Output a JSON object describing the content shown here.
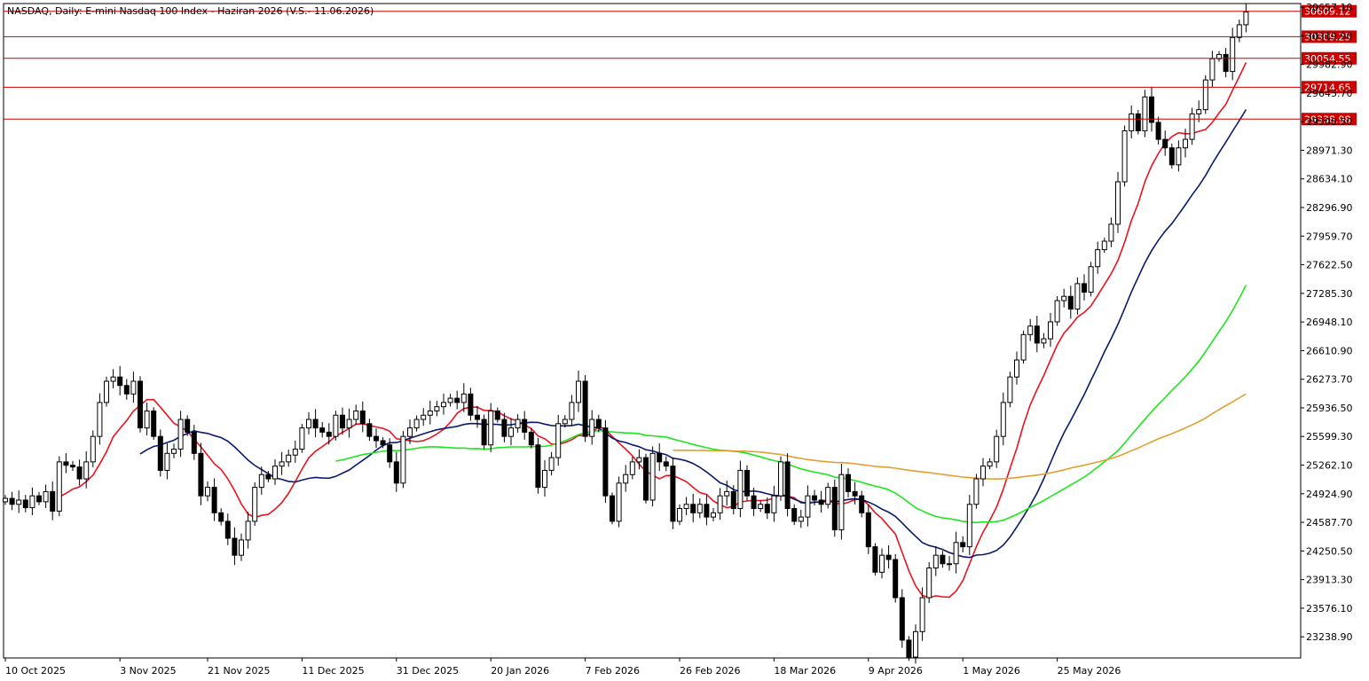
{
  "chart_title": "NASDAQ, Daily:  E-mini Nasdaq 100 Index -  Haziran 2026 (V.S.- 11.06.2026)",
  "chart_data": {
    "type": "candlestick",
    "title": "NASDAQ, Daily:  E-mini Nasdaq 100 Index -  Haziran 2026 (V.S.- 11.06.2026)",
    "ylim": [
      22990,
      30700
    ],
    "grid": false,
    "y_ticks": [
      "30657.10",
      "30319.90",
      "29982.90",
      "29645.70",
      "29308.50",
      "28971.30",
      "28634.10",
      "28296.90",
      "27959.70",
      "27622.50",
      "27285.30",
      "26948.10",
      "26610.90",
      "26273.70",
      "25936.50",
      "25599.30",
      "25262.10",
      "24924.90",
      "24587.70",
      "24250.50",
      "23913.30",
      "23576.10",
      "23238.90"
    ],
    "x_tick_labels": [
      "10 Oct 2025",
      "3 Nov 2025",
      "21 Nov 2025",
      "11 Dec 2025",
      "31 Dec 2025",
      "20 Jan 2026",
      "7 Feb 2026",
      "26 Feb 2026",
      "18 Mar 2026",
      "9 Apr 2026",
      "1 May 2026",
      "25 May 2026"
    ],
    "x_tick_bar_index": [
      0,
      17,
      30,
      44,
      58,
      72,
      86,
      100,
      114,
      128,
      142,
      156
    ],
    "levels": [
      {
        "label": "30609.12",
        "value": 30609.12,
        "color": "#cc0000"
      },
      {
        "label": "30309.25",
        "value": 30309.25,
        "color": "#cc0000"
      },
      {
        "label": "30054.55",
        "value": 30054.55,
        "color": "#cc0000"
      },
      {
        "label": "29714.65",
        "value": 29714.65,
        "color": "#cc0000"
      },
      {
        "label": "29338.98",
        "value": 29338.98,
        "color": "#cc0000"
      }
    ],
    "bullish_color": "#ffffff",
    "bearish_color": "#000000",
    "close": [
      24870,
      24800,
      24850,
      24760,
      24900,
      24830,
      24950,
      24720,
      25300,
      25260,
      25240,
      25100,
      25300,
      25600,
      26000,
      26250,
      26300,
      26200,
      26100,
      26250,
      25700,
      25900,
      25600,
      25200,
      25400,
      25450,
      25800,
      25650,
      25400,
      24900,
      25000,
      24700,
      24600,
      24400,
      24200,
      24380,
      24600,
      25000,
      25150,
      25100,
      25250,
      25300,
      25380,
      25450,
      25700,
      25800,
      25700,
      25650,
      25600,
      25850,
      25700,
      25800,
      25900,
      25750,
      25600,
      25550,
      25500,
      25300,
      25050,
      25600,
      25700,
      25800,
      25850,
      25900,
      25950,
      26000,
      26050,
      26000,
      26100,
      25850,
      25800,
      25500,
      25900,
      25800,
      25600,
      25700,
      25800,
      25650,
      25500,
      25000,
      25200,
      25350,
      25750,
      25800,
      26000,
      26250,
      25600,
      25800,
      25700,
      24900,
      24600,
      25050,
      25150,
      25300,
      25350,
      24850,
      25400,
      25300,
      25250,
      24600,
      24750,
      24800,
      24700,
      24800,
      24650,
      24700,
      24900,
      24950,
      24750,
      25200,
      24900,
      24750,
      24800,
      24700,
      24900,
      25300,
      24750,
      24600,
      24650,
      24900,
      24850,
      24800,
      25000,
      24500,
      25150,
      24950,
      24900,
      24700,
      24300,
      24000,
      24200,
      24150,
      23700,
      23200,
      23000,
      23300,
      23700,
      24050,
      24200,
      24100,
      24100,
      24350,
      24300,
      24800,
      25100,
      25250,
      25300,
      25600,
      26000,
      26300,
      26500,
      26800,
      26900,
      26700,
      26750,
      26950,
      27200,
      27250,
      27100,
      27400,
      27300,
      27600,
      27800,
      27900,
      28100,
      28600,
      29200,
      29400,
      29200,
      29600,
      29300,
      29100,
      29000,
      28800,
      29000,
      29100,
      29400,
      29450,
      29800,
      30050,
      30100,
      29900,
      30300,
      30450,
      30600
    ]
  }
}
